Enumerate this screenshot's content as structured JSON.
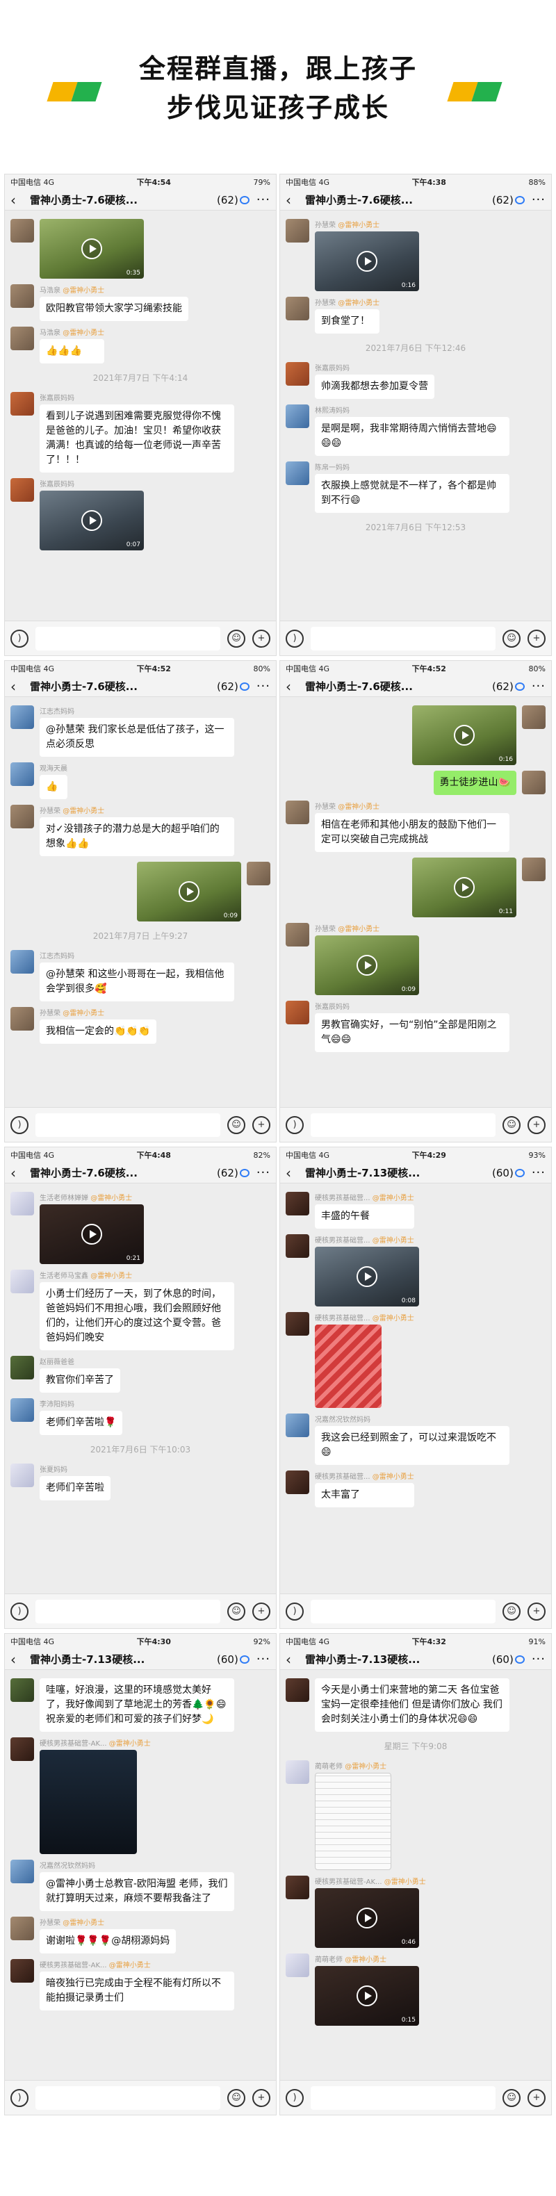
{
  "banner": {
    "line1": "全程群直播，跟上孩子",
    "line2": "步伐见证孩子成长",
    "colors": [
      "#f6b400",
      "#23b14d"
    ]
  },
  "screens": [
    {
      "status": {
        "carrier": "中国电信 4G",
        "time": "下午4:54",
        "battery": "79%"
      },
      "title": "雷神小勇士-7.6硬核...",
      "count": "(62)",
      "messages": [
        {
          "type": "video",
          "side": "left",
          "dur": "0:35",
          "v": "v3"
        },
        {
          "type": "text",
          "side": "left",
          "name": "马浩泉",
          "tag": "@雷神小勇士",
          "text": "欧阳教官带领大家学习绳索技能"
        },
        {
          "type": "text",
          "side": "left",
          "name": "马浩泉",
          "tag": "@雷神小勇士",
          "text": "👍👍👍"
        },
        {
          "type": "time",
          "text": "2021年7月7日 下午4:14"
        },
        {
          "type": "text",
          "side": "left",
          "name": "张嘉辰妈妈",
          "avc": "c2",
          "text": "看到儿子说遇到困难需要克服觉得你不愧是爸爸的儿子。加油！宝贝！希望你收获满满！也真诚的给每一位老师说一声辛苦了！！！"
        },
        {
          "type": "video",
          "side": "left",
          "name": "张嘉辰妈妈",
          "avc": "c2",
          "dur": "0:07",
          "v": "v2"
        }
      ]
    },
    {
      "status": {
        "carrier": "中国电信 4G",
        "time": "下午4:38",
        "battery": "88%"
      },
      "title": "雷神小勇士-7.6硬核...",
      "count": "(62)",
      "messages": [
        {
          "type": "video",
          "side": "left",
          "name": "孙慧荣",
          "tag": "@雷神小勇士",
          "dur": "0:16",
          "v": "v2"
        },
        {
          "type": "text",
          "side": "left",
          "name": "孙慧荣",
          "tag": "@雷神小勇士",
          "text": "到食堂了！"
        },
        {
          "type": "time",
          "text": "2021年7月6日 下午12:46"
        },
        {
          "type": "text",
          "side": "left",
          "name": "张嘉辰妈妈",
          "avc": "c2",
          "text": "帅滴我都想去参加夏令营"
        },
        {
          "type": "text",
          "side": "left",
          "name": "林熙涛妈妈",
          "avc": "c3",
          "text": "是啊是啊，我非常期待周六悄悄去营地😄😄😄"
        },
        {
          "type": "text",
          "side": "left",
          "name": "陈帛一妈妈",
          "avc": "c3",
          "text": "衣服换上感觉就是不一样了，各个都是帅到不行😄"
        },
        {
          "type": "time",
          "text": "2021年7月6日 下午12:53"
        }
      ]
    },
    {
      "status": {
        "carrier": "中国电信 4G",
        "time": "下午4:52",
        "battery": "80%"
      },
      "title": "雷神小勇士-7.6硬核...",
      "count": "(62)",
      "messages": [
        {
          "type": "text",
          "side": "left",
          "name": "江志杰妈妈",
          "avc": "c3",
          "text": "@孙慧荣 我们家长总是低估了孩子，这一点必须反思"
        },
        {
          "type": "text",
          "side": "left",
          "name": "观海天晨",
          "avc": "c3",
          "text": "👍"
        },
        {
          "type": "text",
          "side": "left",
          "name": "孙慧荣",
          "tag": "@雷神小勇士",
          "text": "对✓没错孩子的潜力总是大的超乎咱们的想象👍👍"
        },
        {
          "type": "video",
          "side": "right",
          "dur": "0:09",
          "v": "v3"
        },
        {
          "type": "time",
          "text": "2021年7月7日 上午9:27"
        },
        {
          "type": "text",
          "side": "left",
          "name": "江志杰妈妈",
          "avc": "c3",
          "text": "@孙慧荣 和这些小哥哥在一起，我相信他会学到很多🥰"
        },
        {
          "type": "text",
          "side": "left",
          "name": "孙慧荣",
          "tag": "@雷神小勇士",
          "text": "我相信一定会的👏👏👏"
        }
      ]
    },
    {
      "status": {
        "carrier": "中国电信 4G",
        "time": "下午4:52",
        "battery": "80%"
      },
      "title": "雷神小勇士-7.6硬核...",
      "count": "(62)",
      "messages": [
        {
          "type": "video",
          "side": "right",
          "dur": "0:16",
          "v": "v3"
        },
        {
          "type": "text",
          "side": "right",
          "text": "勇士徒步进山🍉"
        },
        {
          "type": "text",
          "side": "left",
          "name": "孙慧荣",
          "tag": "@雷神小勇士",
          "text": "相信在老师和其他小朋友的鼓励下他们一定可以突破自己完成挑战"
        },
        {
          "type": "video",
          "side": "right",
          "dur": "0:11",
          "v": "v3"
        },
        {
          "type": "video",
          "side": "left",
          "name": "孙慧荣",
          "tag": "@雷神小勇士",
          "dur": "0:09",
          "v": "v3"
        },
        {
          "type": "text",
          "side": "left",
          "name": "张嘉辰妈妈",
          "avc": "c2",
          "text": "男教官确实好，一句“别怕”全部是阳刚之气😄😄"
        }
      ]
    },
    {
      "status": {
        "carrier": "中国电信 4G",
        "time": "下午4:48",
        "battery": "82%"
      },
      "title": "雷神小勇士-7.6硬核...",
      "count": "(62)",
      "messages": [
        {
          "type": "video",
          "side": "left",
          "name": "生活老师林婵婵",
          "tag": "@雷神小勇士",
          "avc": "c4",
          "dur": "0:21",
          "v": "v4"
        },
        {
          "type": "text",
          "side": "left",
          "name": "生活老师马宝鑫",
          "tag": "@雷神小勇士",
          "avc": "c4",
          "text": "小勇士们经历了一天，到了休息的时间，爸爸妈妈们不用担心哦，我们会照顾好他们的，让他们开心的度过这个夏令营。爸爸妈妈们晚安"
        },
        {
          "type": "text",
          "side": "left",
          "name": "赵丽薇爸爸",
          "avc": "c5",
          "text": "教官你们辛苦了"
        },
        {
          "type": "text",
          "side": "left",
          "name": "李沛阳妈妈",
          "avc": "c3",
          "text": "老师们辛苦啦🌹"
        },
        {
          "type": "time",
          "text": "2021年7月6日 下午10:03"
        },
        {
          "type": "text",
          "side": "left",
          "name": "张夏妈妈",
          "avc": "c4",
          "text": "老师们辛苦啦"
        }
      ]
    },
    {
      "status": {
        "carrier": "中国电信 4G",
        "time": "下午4:29",
        "battery": "93%"
      },
      "title": "雷神小勇士-7.13硬核...",
      "count": "(60)",
      "messages": [
        {
          "type": "text",
          "side": "left",
          "name": "硬核男孩基础营...",
          "tag": "@雷神小勇士",
          "avc": "c6",
          "text": "丰盛的午餐"
        },
        {
          "type": "video",
          "side": "left",
          "name": "硬核男孩基础营...",
          "tag": "@雷神小勇士",
          "avc": "c6",
          "dur": "0:08",
          "v": "v2"
        },
        {
          "type": "photo",
          "side": "left",
          "name": "硬核男孩基础营...",
          "tag": "@雷神小勇士",
          "avc": "c6",
          "p": ""
        },
        {
          "type": "text",
          "side": "left",
          "name": "况嘉然况钦然妈妈",
          "avc": "c3",
          "text": "我这会已经到照金了，可以过来混饭吃不😄"
        },
        {
          "type": "text",
          "side": "left",
          "name": "硬核男孩基础营...",
          "tag": "@雷神小勇士",
          "avc": "c6",
          "text": "太丰富了"
        }
      ]
    },
    {
      "status": {
        "carrier": "中国电信 4G",
        "time": "下午4:30",
        "battery": "92%"
      },
      "title": "雷神小勇士-7.13硬核...",
      "count": "(60)",
      "messages": [
        {
          "type": "text",
          "side": "left",
          "avc": "c5",
          "text": "哇噻，好浪漫，这里的环境感觉太美好了，我好像闻到了草地泥土的芳香🌲🌻😄祝亲爱的老师们和可爱的孩子们好梦🌙"
        },
        {
          "type": "photo",
          "side": "left",
          "name": "硬核男孩基础营-AK...",
          "tag": "@雷神小勇士",
          "avc": "c6",
          "p": "p2"
        },
        {
          "type": "text",
          "side": "left",
          "name": "况嘉然况钦然妈妈",
          "avc": "c3",
          "text": "@雷神小勇士总教官-欧阳海盟 老师，我们就打算明天过来，麻烦不要帮我备注了"
        },
        {
          "type": "text",
          "side": "left",
          "name": "孙慧荣",
          "tag": "@雷神小勇士",
          "text": "谢谢啦🌹🌹🌹@胡栩源妈妈"
        },
        {
          "type": "text",
          "side": "left",
          "name": "硬核男孩基础营-AK...",
          "tag": "@雷神小勇士",
          "avc": "c6",
          "text": "暗夜独行已完成由于全程不能有灯所以不能拍摄记录勇士们"
        }
      ]
    },
    {
      "status": {
        "carrier": "中国电信 4G",
        "time": "下午4:32",
        "battery": "91%"
      },
      "title": "雷神小勇士-7.13硬核...",
      "count": "(60)",
      "messages": [
        {
          "type": "text",
          "side": "left",
          "avc": "c6",
          "text": "今天是小勇士们来营地的第二天 各位宝爸宝妈一定很牵挂他们 但是请你们放心 我们会时刻关注小勇士们的身体状况😄😄"
        },
        {
          "type": "time",
          "text": "星期三 下午9:08"
        },
        {
          "type": "photo",
          "side": "left",
          "name": "蔺萌老师",
          "tag": "@雷神小勇士",
          "avc": "c4",
          "p": "p3"
        },
        {
          "type": "video",
          "side": "left",
          "name": "硬核男孩基础营-AK...",
          "tag": "@雷神小勇士",
          "avc": "c6",
          "dur": "0:46",
          "v": "v4"
        },
        {
          "type": "video",
          "side": "left",
          "name": "蔺萌老师",
          "tag": "@雷神小勇士",
          "avc": "c4",
          "dur": "0:15",
          "v": "v4"
        }
      ]
    }
  ]
}
